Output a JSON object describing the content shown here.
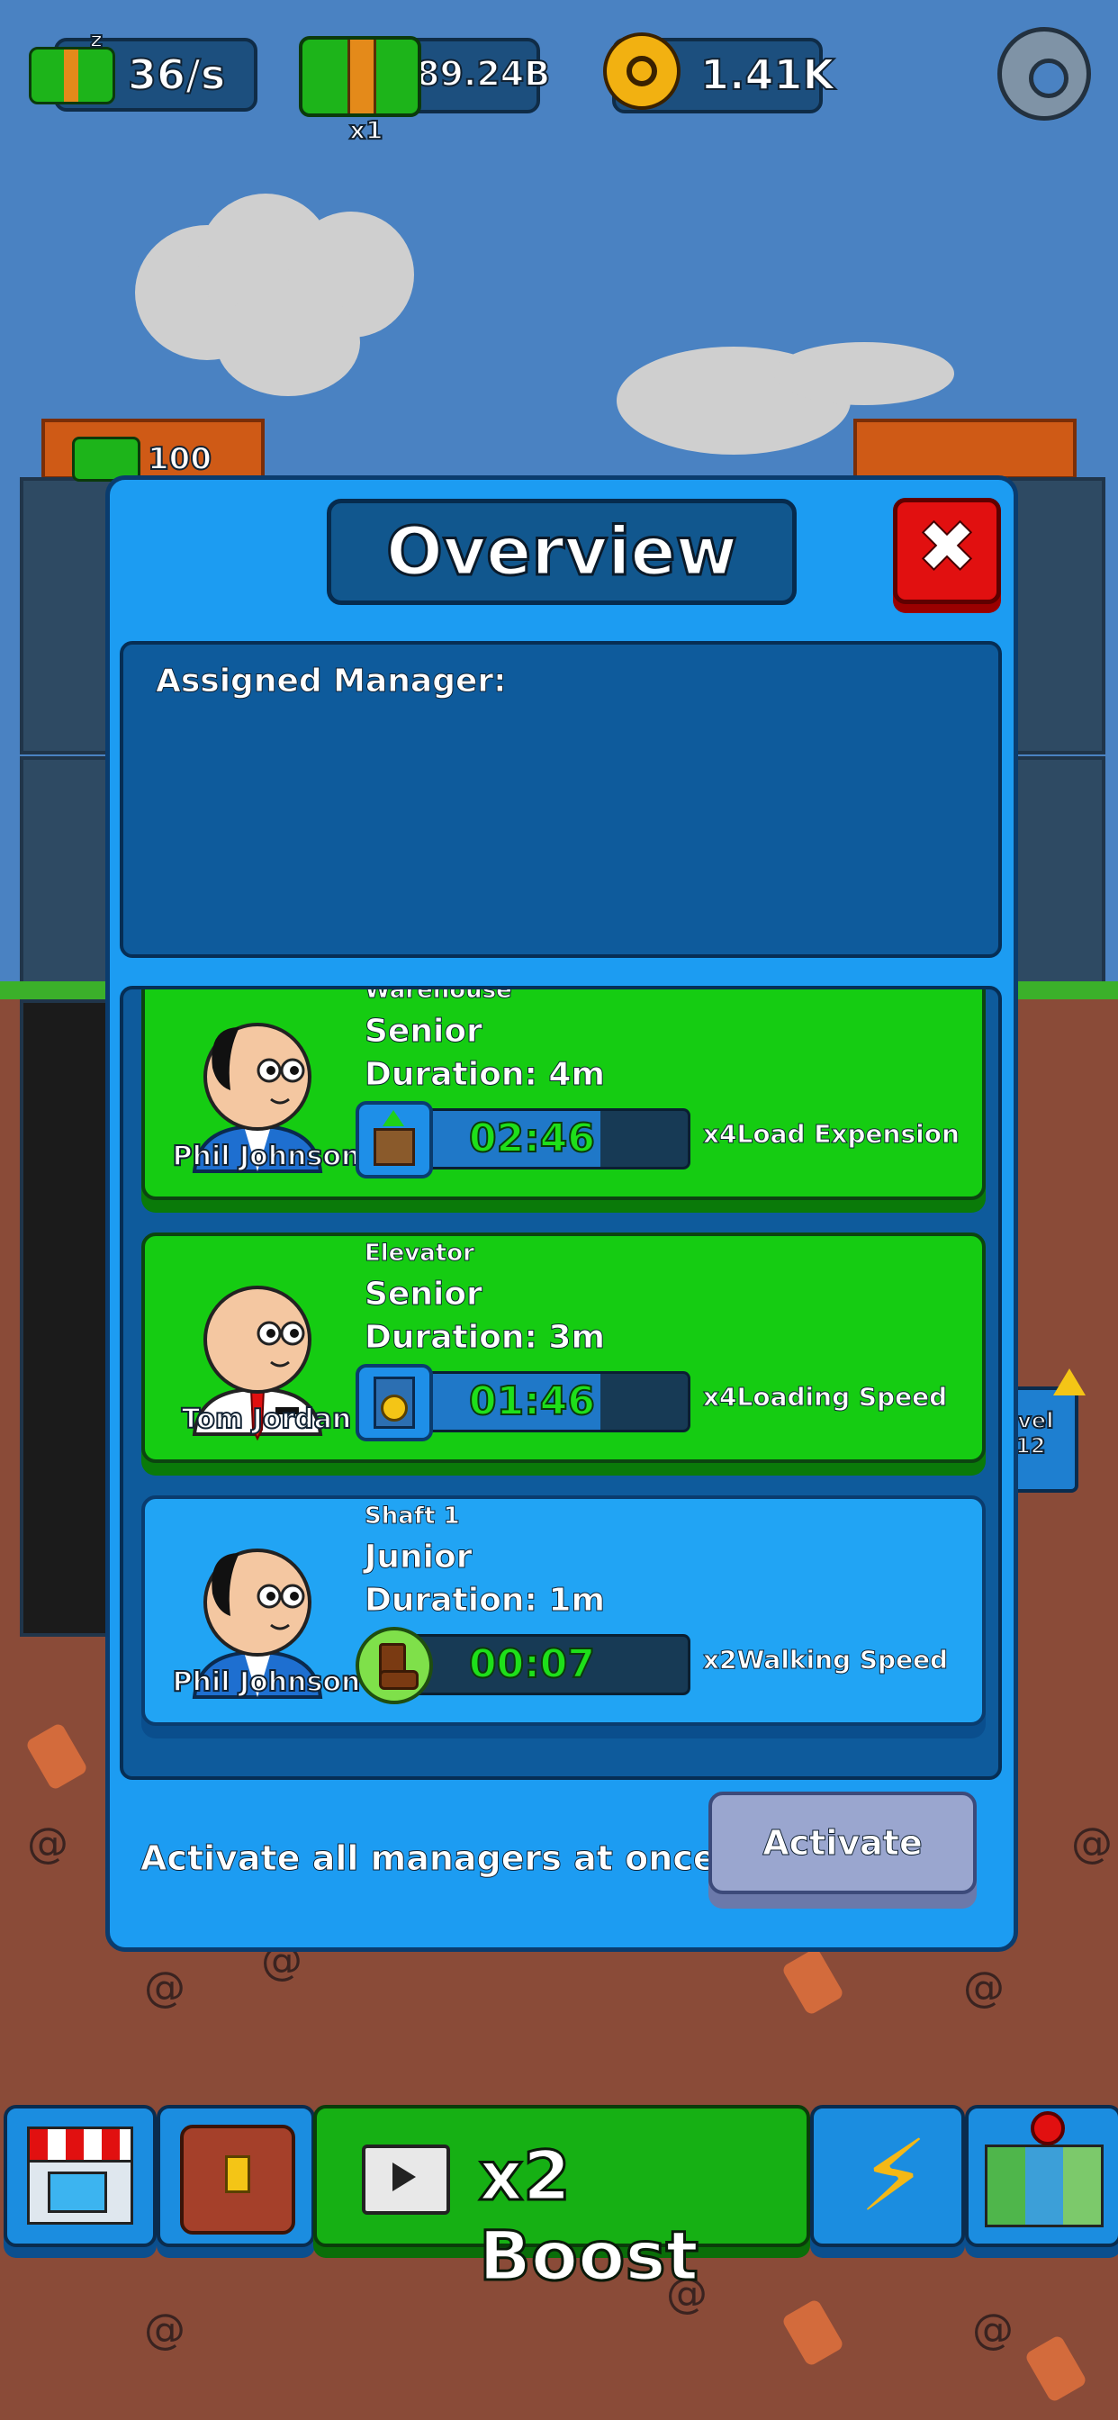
{
  "hud": {
    "idle_rate": "36/s",
    "cash": "89.24B",
    "cash_multiplier": "x1",
    "coins": "1.41K"
  },
  "background": {
    "left_building_cost": "100",
    "right_level_label": "evel",
    "right_level_number": "12"
  },
  "overview": {
    "title": "Overview",
    "assigned_label": "Assigned Manager:",
    "managers": [
      {
        "name": "Phil Johnson",
        "category": "Warehouse",
        "rank": "Senior",
        "duration": "Duration: 4m",
        "timer": "02:46",
        "progress": 0.72,
        "effect": "x4Load Expension",
        "icon": "crate-up-icon",
        "tie": "blue"
      },
      {
        "name": "Tom Jordan",
        "category": "Elevator",
        "rank": "Senior",
        "duration": "Duration: 3m",
        "timer": "01:46",
        "progress": 0.72,
        "effect": "x4Loading Speed",
        "icon": "elevator-gear-icon",
        "tie": "red"
      },
      {
        "name": "Phil Johnson",
        "category": "Shaft 1",
        "rank": "Junior",
        "duration": "Duration: 1m",
        "timer": "00:07",
        "progress": 0.03,
        "effect": "x2Walking Speed",
        "icon": "boot-icon",
        "tie": "blue"
      }
    ],
    "activate_all_text": "Activate all managers at once.",
    "activate_button": "Activate"
  },
  "bottom_nav": {
    "boost_label": "x2 Boost",
    "icons": [
      "shop-icon",
      "chest-icon",
      "video-clapper-icon",
      "lightning-icon",
      "map-icon"
    ]
  },
  "colors": {
    "panel": "#1c9cf2",
    "active_card": "#15cc12",
    "idle_card": "#21a4f4",
    "close": "#e11010",
    "timer_text": "#1ee01a"
  }
}
